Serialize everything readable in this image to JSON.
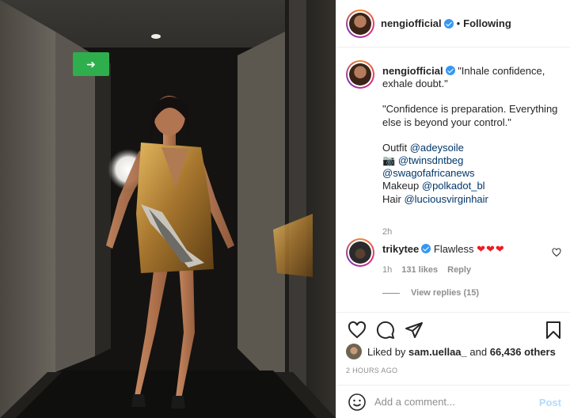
{
  "post": {
    "author": "nengiofficial",
    "follow_state": "Following",
    "separator": "•",
    "exit_sign_icon": "exit-sign",
    "caption": {
      "username": "nengiofficial",
      "lines": [
        "\"Inhale confidence,",
        "exhale doubt.\"",
        "",
        "\"Confidence is preparation. Everything",
        "else is beyond your control.\"",
        ""
      ],
      "outfit_label": "Outfit",
      "outfit_mention": "@adeysoile",
      "camera_emoji": "📷",
      "camera_mention": "@twinsdntbeg",
      "extra_mention": "@swagofafricanews",
      "makeup_label": "Makeup",
      "makeup_mention": "@polkadot_bl",
      "hair_label": "Hair",
      "hair_mention": "@luciousvirginhair",
      "time": "2h"
    },
    "comment": {
      "username": "trikytee",
      "text": "Flawless",
      "hearts": "❤❤❤",
      "time": "1h",
      "likes": "131 likes",
      "reply_label": "Reply",
      "view_replies": "View replies (15)"
    },
    "likes": {
      "prefix": "Liked by",
      "user": "sam.uellaa_",
      "joiner": "and",
      "others": "66,436 others"
    },
    "timestamp": "2 HOURS AGO",
    "add_comment": {
      "placeholder": "Add a comment...",
      "post_label": "Post"
    },
    "colors": {
      "verified": "#3897f0",
      "mention": "#00376b",
      "post_disabled": "#b3dbff",
      "hearts": "#ed1c24"
    }
  }
}
